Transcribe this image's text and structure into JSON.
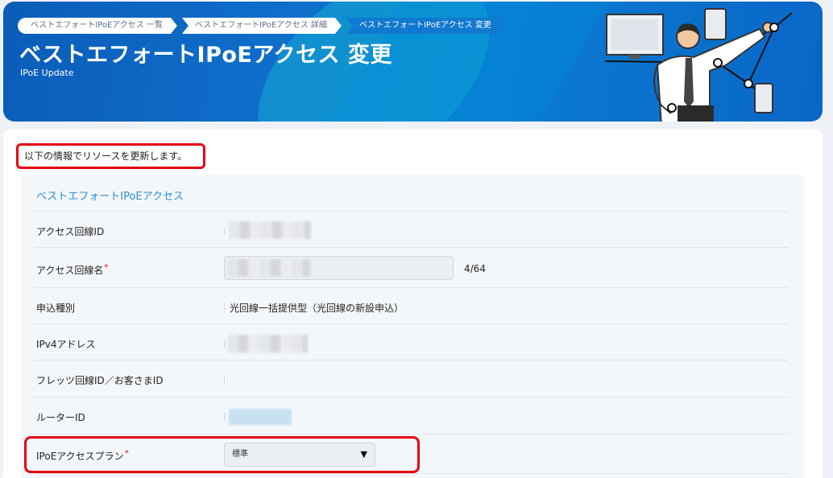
{
  "breadcrumb": [
    "ベストエフォートIPoEアクセス 一覧",
    "ベストエフォートIPoEアクセス 詳細",
    "ベストエフォートIPoEアクセス 変更"
  ],
  "header": {
    "title": "ベストエフォートIPoEアクセス 変更",
    "subtitle": "IPoE Update"
  },
  "notice": "以下の情報でリソースを更新します。",
  "section": {
    "title": "ベストエフォートIPoEアクセス",
    "fields": {
      "access_line_id": {
        "label": "アクセス回線ID"
      },
      "access_line_name": {
        "label": "アクセス回線名",
        "required_mark": "*",
        "counter": "4/64"
      },
      "application_type": {
        "label": "申込種別",
        "value": "光回線一括提供型（光回線の新設申込）"
      },
      "ipv4_address": {
        "label": "IPv4アドレス"
      },
      "flets_line_id": {
        "label": "フレッツ回線ID／お客さまID",
        "value": ""
      },
      "router_id": {
        "label": "ルーターID"
      },
      "ipoe_plan": {
        "label": "IPoEアクセスプラン",
        "required_mark": "*",
        "selected": "標準",
        "caret": "▼"
      }
    }
  },
  "colors": {
    "banner": "#0a5db8",
    "accent": "#2a8fd4",
    "required": "#e60012",
    "highlight": "#e60012"
  },
  "icons": {
    "plan_dropdown": "caret-down-icon"
  }
}
